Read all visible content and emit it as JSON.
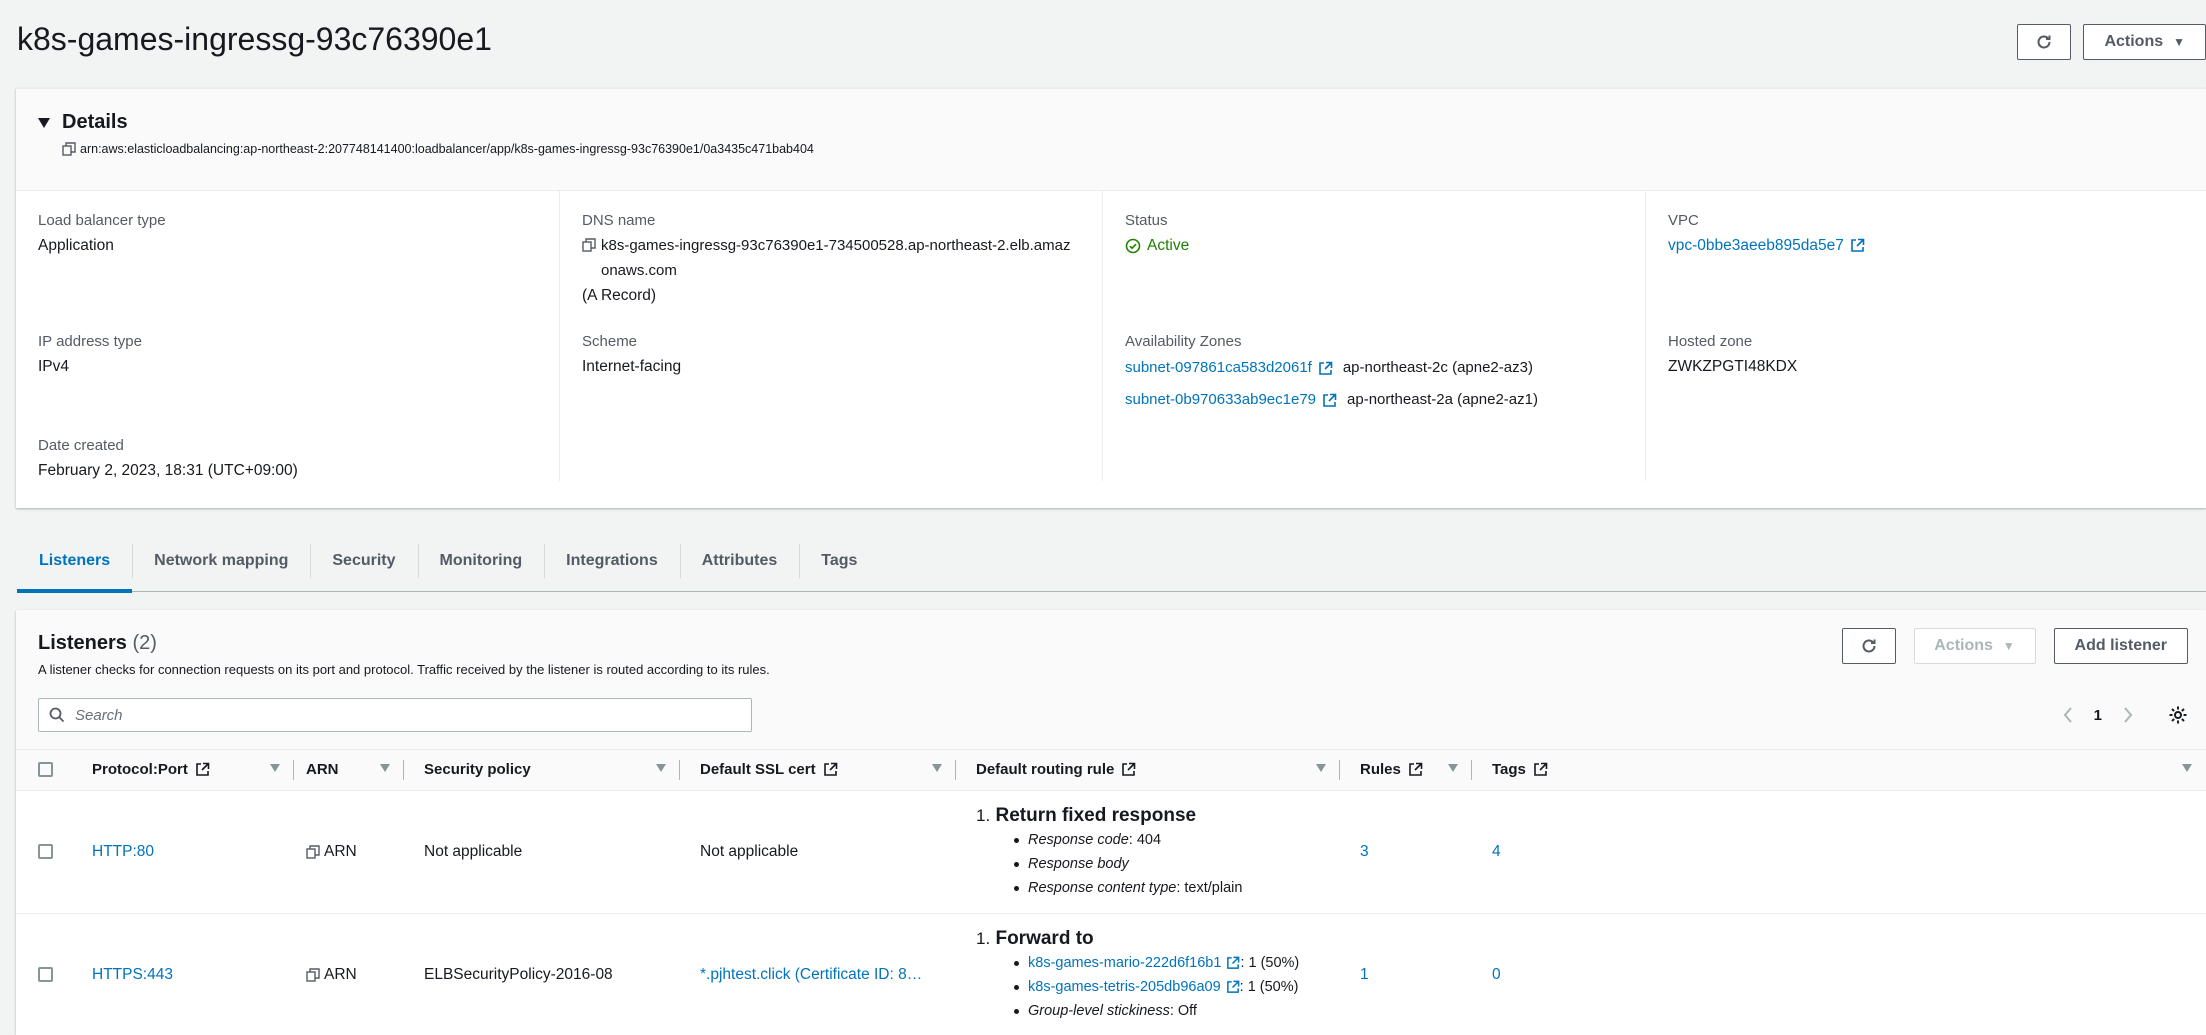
{
  "header": {
    "title": "k8s-games-ingressg-93c76390e1",
    "refresh_icon": "refresh-icon",
    "actions_label": "Actions"
  },
  "details": {
    "title": "Details",
    "arn": "arn:aws:elasticloadbalancing:ap-northeast-2:207748141400:loadbalancer/app/k8s-games-ingressg-93c76390e1/0a3435c471bab404",
    "lb_type": {
      "label": "Load balancer type",
      "value": "Application"
    },
    "dns": {
      "label": "DNS name",
      "value_line1": "k8s-games-ingressg-93c76390e1-734500528.ap-northeast-2.elb.amaz",
      "value_line2": "onaws.com",
      "record": "(A Record)"
    },
    "status": {
      "label": "Status",
      "value": "Active"
    },
    "vpc": {
      "label": "VPC",
      "value": "vpc-0bbe3aeeb895da5e7"
    },
    "ip_type": {
      "label": "IP address type",
      "value": "IPv4"
    },
    "scheme": {
      "label": "Scheme",
      "value": "Internet-facing"
    },
    "azs": {
      "label": "Availability Zones",
      "items": [
        {
          "subnet": "subnet-097861ca583d2061f",
          "zone": "ap-northeast-2c (apne2-az3)"
        },
        {
          "subnet": "subnet-0b970633ab9ec1e79",
          "zone": "ap-northeast-2a (apne2-az1)"
        }
      ]
    },
    "hosted_zone": {
      "label": "Hosted zone",
      "value": "ZWKZPGTI48KDX"
    },
    "date_created": {
      "label": "Date created",
      "value": "February 2, 2023, 18:31 (UTC+09:00)"
    }
  },
  "tabs": [
    {
      "label": "Listeners",
      "active": true
    },
    {
      "label": "Network mapping"
    },
    {
      "label": "Security"
    },
    {
      "label": "Monitoring"
    },
    {
      "label": "Integrations"
    },
    {
      "label": "Attributes"
    },
    {
      "label": "Tags"
    }
  ],
  "listeners": {
    "title": "Listeners",
    "count": "(2)",
    "description": "A listener checks for connection requests on its port and protocol. Traffic received by the listener is routed according to its rules.",
    "actions_label": "Actions",
    "add_label": "Add listener",
    "search_placeholder": "Search",
    "page": "1",
    "columns": [
      "Protocol:Port",
      "ARN",
      "Security policy",
      "Default SSL cert",
      "Default routing rule",
      "Rules",
      "Tags"
    ],
    "rows": [
      {
        "protocol_port": "HTTP:80",
        "arn": "ARN",
        "security_policy": "Not applicable",
        "ssl_cert": "Not applicable",
        "rule_num": "1.",
        "rule_title": "Return fixed response",
        "rule_details": [
          {
            "key": "Response code",
            "value": ": 404"
          },
          {
            "key": "Response body",
            "value": ""
          },
          {
            "key": "Response content type",
            "value": ": text/plain"
          }
        ],
        "rules": "3",
        "tags": "4"
      },
      {
        "protocol_port": "HTTPS:443",
        "arn": "ARN",
        "security_policy": "ELBSecurityPolicy-2016-08",
        "ssl_cert": "*.pjhtest.click (Certificate ID: 8…",
        "rule_num": "1.",
        "rule_title": "Forward to",
        "targets": [
          {
            "name": "k8s-games-mario-222d6f16b1",
            "weight": ": 1 (50%)"
          },
          {
            "name": "k8s-games-tetris-205db96a09",
            "weight": ": 1 (50%)"
          }
        ],
        "stickiness_key": "Group-level stickiness",
        "stickiness_value": ": Off",
        "rules": "1",
        "tags": "0"
      }
    ]
  },
  "colors": {
    "link": "#0073bb",
    "success": "#1d8102",
    "text": "#16191f"
  }
}
